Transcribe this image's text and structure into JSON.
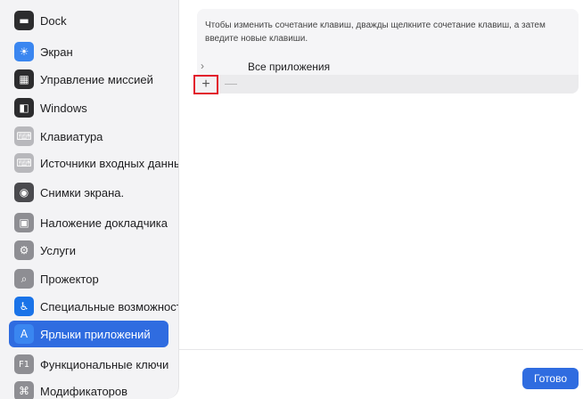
{
  "sidebar": {
    "items": [
      {
        "label": "Dock",
        "icon": "dock-icon",
        "glyph": "▬",
        "color": "#2c2c2e",
        "selected": false
      },
      {
        "label": "Экран",
        "icon": "display-icon",
        "glyph": "☀",
        "color": "#3a86f0",
        "selected": false
      },
      {
        "label": "Управление миссией",
        "icon": "mission-control-icon",
        "glyph": "▦",
        "color": "#2c2c2e",
        "selected": false
      },
      {
        "label": "Windows",
        "icon": "windows-icon",
        "glyph": "◧",
        "color": "#2c2c2e",
        "selected": false
      },
      {
        "label": "Клавиатура",
        "icon": "keyboard-icon",
        "glyph": "⌨",
        "color": "#b8b8bc",
        "selected": false
      },
      {
        "label": "Источники входных данных",
        "icon": "input-sources-icon",
        "glyph": "⌨",
        "color": "#b8b8bc",
        "selected": false
      },
      {
        "label": "Снимки экрана.",
        "icon": "screenshot-icon",
        "glyph": "◉",
        "color": "#4a4a4e",
        "selected": false
      },
      {
        "label": "Наложение докладчика",
        "icon": "presenter-overlay-icon",
        "glyph": "▣",
        "color": "#8e8e93",
        "selected": false
      },
      {
        "label": "Услуги",
        "icon": "services-icon",
        "glyph": "⚙",
        "color": "#8e8e93",
        "selected": false
      },
      {
        "label": "Прожектор",
        "icon": "spotlight-icon",
        "glyph": "⌕",
        "color": "#8e8e93",
        "selected": false
      },
      {
        "label": "Специальные возможности",
        "icon": "accessibility-icon",
        "glyph": "♿",
        "color": "#1a73e8",
        "selected": false
      },
      {
        "label": "Ярлыки приложений",
        "icon": "app-shortcuts-icon",
        "glyph": "A",
        "color": "#3a86f0",
        "selected": true
      },
      {
        "label": "Функциональные ключи",
        "icon": "function-keys-icon",
        "glyph": "F1",
        "color": "#8e8e93",
        "selected": false
      },
      {
        "label": "Модификаторов",
        "icon": "modifier-keys-icon",
        "glyph": "⌘",
        "color": "#8e8e93",
        "selected": false
      }
    ]
  },
  "content": {
    "description": "Чтобы изменить сочетание клавиш, дважды щелкните сочетание клавиш, а затем введите новые клавиши.",
    "tree_item": "Все приложения",
    "chevron": "›",
    "add": "+",
    "remove": "—"
  },
  "footer": {
    "done_label": "Готово"
  }
}
